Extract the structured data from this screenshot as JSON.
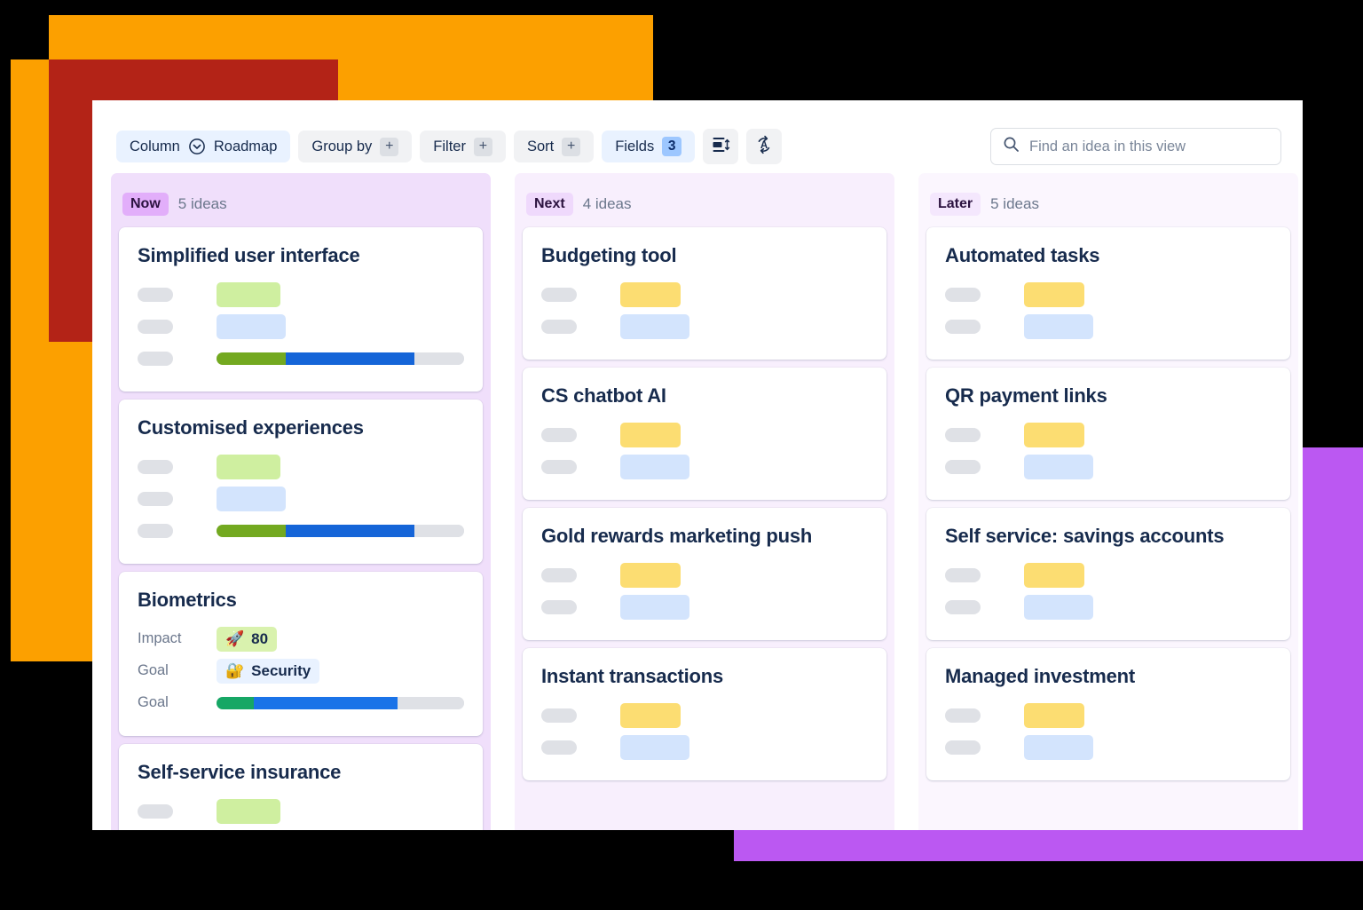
{
  "theme": {
    "accent_orange": "#FCA000",
    "accent_red": "#B32317",
    "accent_purple": "#BB58F2",
    "text_primary": "#172B4D",
    "text_muted": "#6B778C",
    "col_now_bg": "#F0DFFB",
    "col_next_bg": "#F8EFFD",
    "col_later_bg": "#FBF6FE"
  },
  "toolbar": {
    "column_label": "Column",
    "column_value": "Roadmap",
    "column_icon": "chevron-down-circle-icon",
    "group_by_label": "Group by",
    "group_by_add": "+",
    "filter_label": "Filter",
    "filter_add": "+",
    "sort_label": "Sort",
    "sort_add": "+",
    "fields_label": "Fields",
    "fields_count": "3",
    "row_height_icon": "row-height-icon",
    "auto_sort_icon": "auto-refresh-a-icon",
    "search_icon": "search-icon",
    "search_placeholder": "Find an idea in this view",
    "search_value": ""
  },
  "board": {
    "columns": [
      {
        "tag": "Now",
        "count": "5 ideas",
        "cards": [
          {
            "title": "Simplified user interface",
            "rows": [
              {
                "type": "chip",
                "label": "",
                "chip_class": "chip-green"
              },
              {
                "type": "chip",
                "label": "",
                "chip_class": "chip-blue"
              },
              {
                "type": "bar",
                "label": "",
                "segments": [
                  {
                    "color": "#73A920",
                    "pct": 28
                  },
                  {
                    "color": "#1565D8",
                    "pct": 52
                  },
                  {
                    "color": "#DFE1E6",
                    "pct": 20
                  }
                ]
              }
            ]
          },
          {
            "title": "Customised experiences",
            "rows": [
              {
                "type": "chip",
                "label": "",
                "chip_class": "chip-green"
              },
              {
                "type": "chip",
                "label": "",
                "chip_class": "chip-blue"
              },
              {
                "type": "bar",
                "label": "",
                "segments": [
                  {
                    "color": "#73A920",
                    "pct": 28
                  },
                  {
                    "color": "#1565D8",
                    "pct": 52
                  },
                  {
                    "color": "#DFE1E6",
                    "pct": 20
                  }
                ]
              }
            ]
          },
          {
            "title": "Biometrics",
            "rows": [
              {
                "type": "value",
                "label": "Impact",
                "emoji": "🚀",
                "value": "80",
                "chip_class": "chip-value"
              },
              {
                "type": "value",
                "label": "Goal",
                "emoji": "🔐",
                "value": "Security",
                "chip_class": "chip-goal"
              },
              {
                "type": "bar",
                "label": "Goal",
                "segments": [
                  {
                    "color": "#16A765",
                    "pct": 15
                  },
                  {
                    "color": "#1A73E8",
                    "pct": 58
                  },
                  {
                    "color": "#DFE1E6",
                    "pct": 27
                  }
                ]
              }
            ]
          },
          {
            "title": "Self-service insurance",
            "rows": [
              {
                "type": "chip",
                "label": "",
                "chip_class": "chip-green"
              },
              {
                "type": "chip",
                "label": "",
                "chip_class": "chip-blue"
              }
            ]
          }
        ]
      },
      {
        "tag": "Next",
        "count": "4 ideas",
        "cards": [
          {
            "title": "Budgeting tool",
            "rows": [
              {
                "type": "chip",
                "label": "",
                "chip_class": "chip-yellow"
              },
              {
                "type": "chip",
                "label": "",
                "chip_class": "chip-blue"
              }
            ]
          },
          {
            "title": "CS chatbot AI",
            "rows": [
              {
                "type": "chip",
                "label": "",
                "chip_class": "chip-yellow"
              },
              {
                "type": "chip",
                "label": "",
                "chip_class": "chip-blue"
              }
            ]
          },
          {
            "title": "Gold rewards marketing push",
            "rows": [
              {
                "type": "chip",
                "label": "",
                "chip_class": "chip-yellow"
              },
              {
                "type": "chip",
                "label": "",
                "chip_class": "chip-blue"
              }
            ]
          },
          {
            "title": "Instant transactions",
            "rows": [
              {
                "type": "chip",
                "label": "",
                "chip_class": "chip-yellow"
              },
              {
                "type": "chip",
                "label": "",
                "chip_class": "chip-blue"
              }
            ]
          }
        ]
      },
      {
        "tag": "Later",
        "count": "5 ideas",
        "cards": [
          {
            "title": "Automated tasks",
            "rows": [
              {
                "type": "chip",
                "label": "",
                "chip_class": "chip-yellow"
              },
              {
                "type": "chip",
                "label": "",
                "chip_class": "chip-blue"
              }
            ]
          },
          {
            "title": "QR payment links",
            "rows": [
              {
                "type": "chip",
                "label": "",
                "chip_class": "chip-yellow"
              },
              {
                "type": "chip",
                "label": "",
                "chip_class": "chip-blue"
              }
            ]
          },
          {
            "title": "Self service: savings accounts",
            "rows": [
              {
                "type": "chip",
                "label": "",
                "chip_class": "chip-yellow"
              },
              {
                "type": "chip",
                "label": "",
                "chip_class": "chip-blue"
              }
            ]
          },
          {
            "title": "Managed investment",
            "rows": [
              {
                "type": "chip",
                "label": "",
                "chip_class": "chip-yellow"
              },
              {
                "type": "chip",
                "label": "",
                "chip_class": "chip-blue"
              }
            ]
          }
        ]
      }
    ]
  }
}
